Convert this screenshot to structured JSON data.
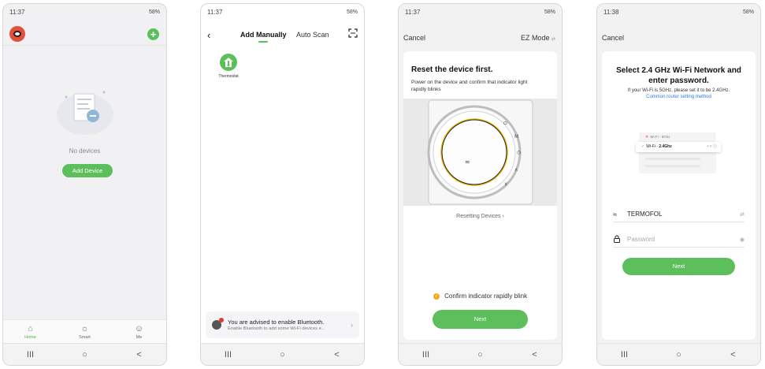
{
  "phones": [
    {
      "status": {
        "time": "11:37",
        "right": "58%"
      },
      "home": {
        "empty_text": "No devices",
        "add_device_label": "Add Device",
        "tabs": [
          {
            "label": "Home",
            "icon": "home-icon",
            "active": true
          },
          {
            "label": "Smart",
            "icon": "sun-icon",
            "active": false
          },
          {
            "label": "Me",
            "icon": "user-icon",
            "active": false
          }
        ]
      }
    },
    {
      "status": {
        "time": "11:37",
        "right": "58%"
      },
      "add": {
        "tab_manual": "Add Manually",
        "tab_auto": "Auto Scan",
        "device_label": "Thermostat",
        "bt_title": "You are advised to enable Bluetooth.",
        "bt_sub": "Enable Bluetooth to add some Wi-Fi devices e..."
      }
    },
    {
      "status": {
        "time": "11:37",
        "right": "58%"
      },
      "reset": {
        "cancel": "Cancel",
        "mode": "EZ Mode",
        "title": "Reset the device first.",
        "desc": "Power on the device and confirm that indicator light rapidly blinks",
        "link": "Resetting Devices",
        "confirm": "Confirm indicator rapidly blink",
        "next": "Next"
      }
    },
    {
      "status": {
        "time": "11:38",
        "right": "58%"
      },
      "wifi": {
        "cancel": "Cancel",
        "title": "Select 2.4 GHz Wi-Fi Network and enter password.",
        "desc": "If your Wi-Fi is 5GHz, please set it to be 2.4GHz.",
        "link": "Common router setting method",
        "mini_5g": "Wi-Fi - 5Ghz",
        "mini_24_prefix": "Wi-Fi - ",
        "mini_24_band": "2.4Ghz",
        "ssid": "TERMOFOL",
        "password_placeholder": "Password",
        "next": "Next"
      }
    }
  ],
  "nav": {
    "recent": "III",
    "home": "○",
    "back": "<"
  },
  "colors": {
    "accent": "#5cbf5c",
    "link": "#2a7ae2",
    "warn": "#f5a623"
  }
}
